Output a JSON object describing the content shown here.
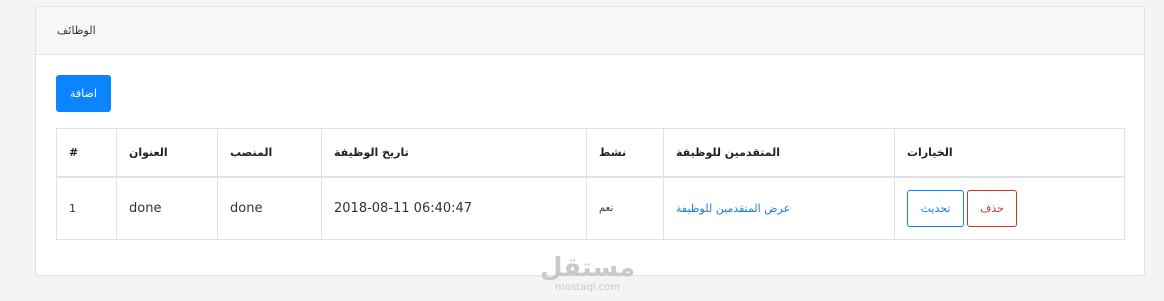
{
  "panel": {
    "title": "الوظائف"
  },
  "toolbar": {
    "add_label": "اضافة"
  },
  "table": {
    "headers": [
      "#",
      "العنوان",
      "المنصب",
      "تاريخ الوظيفة",
      "نشط",
      "المتقدمين للوظيفة",
      "الخيارات"
    ],
    "rows": [
      {
        "num": "1",
        "title": "done",
        "position": "done",
        "date": "2018-08-11 06:40:47",
        "active": "نعم",
        "applicants_link": "عرض المتقدمين للوظيفة",
        "update_label": "تحديث",
        "delete_label": "حذف"
      }
    ]
  },
  "watermark": {
    "arabic": "مستقل",
    "latin": "mostaql.com"
  },
  "colors": {
    "primary": "#0a84ff",
    "danger": "#d0342c",
    "link": "#1a7fe0"
  }
}
